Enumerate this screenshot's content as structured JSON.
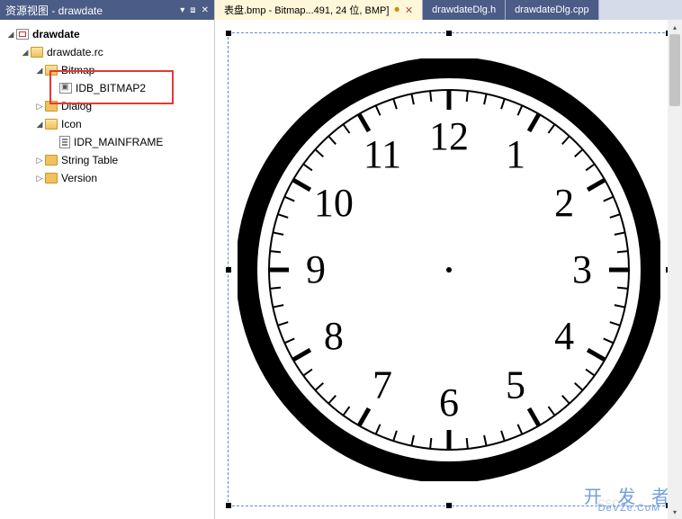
{
  "panel": {
    "title": "资源视图 - drawdate"
  },
  "tree": {
    "root": "drawdate",
    "items": [
      {
        "label": "drawdate.rc",
        "level": 1,
        "type": "folder-open",
        "expanded": true
      },
      {
        "label": "Bitmap",
        "level": 2,
        "type": "folder-open",
        "expanded": true
      },
      {
        "label": "IDB_BITMAP2",
        "level": 3,
        "type": "bmp",
        "highlighted": true
      },
      {
        "label": "Dialog",
        "level": 2,
        "type": "folder",
        "expanded": false
      },
      {
        "label": "Icon",
        "level": 2,
        "type": "folder-open",
        "expanded": true
      },
      {
        "label": "IDR_MAINFRAME",
        "level": 3,
        "type": "file"
      },
      {
        "label": "String Table",
        "level": 2,
        "type": "folder",
        "expanded": false
      },
      {
        "label": "Version",
        "level": 2,
        "type": "folder",
        "expanded": false
      }
    ]
  },
  "tabs": [
    {
      "label": "表盘.bmp - Bitmap...491, 24 位, BMP]",
      "active": true,
      "closable": true
    },
    {
      "label": "drawdateDlg.h",
      "blue": true
    },
    {
      "label": "drawdateDlg.cpp",
      "blue": true
    }
  ],
  "watermark": {
    "main": "开 发 者",
    "sub": "DeVZe.CoM",
    "csdn": "CSDN"
  },
  "clock": {
    "numerals": [
      "12",
      "1",
      "2",
      "3",
      "4",
      "5",
      "6",
      "7",
      "8",
      "9",
      "10",
      "11"
    ]
  }
}
